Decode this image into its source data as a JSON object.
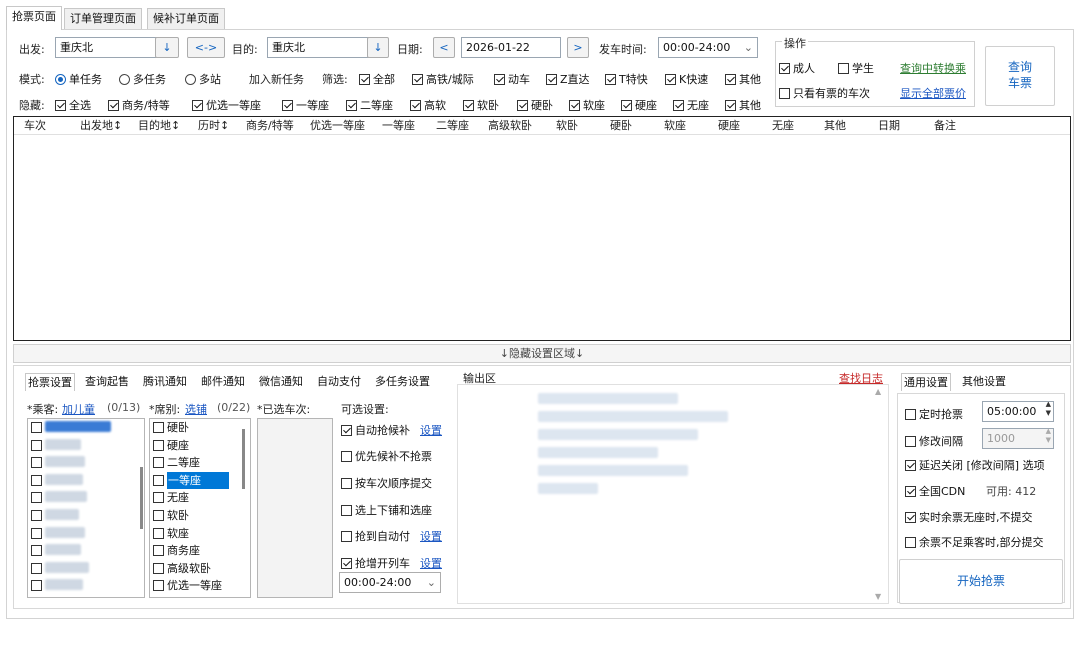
{
  "tabs": [
    "抢票页面",
    "订单管理页面",
    "候补订单页面"
  ],
  "route": {
    "from_label": "出发:",
    "from_value": "重庆北",
    "down_arrow": "↓",
    "swap": "<->",
    "to_label": "目的:",
    "to_value": "重庆北",
    "date_label": "日期:",
    "prev": "<",
    "date_value": "2026-01-22",
    "next": ">",
    "time_label": "发车时间:",
    "time_value": "00:00-24:00"
  },
  "mode": {
    "label": "模式:",
    "single": "单任务",
    "multi": "多任务",
    "multi_station": "多站",
    "add_task": "加入新任务",
    "filter_label": "筛选:",
    "filters": [
      "全部",
      "高铁/城际",
      "动车",
      "Z直达",
      "T特快",
      "K快速",
      "其他"
    ]
  },
  "hide": {
    "label": "隐藏:",
    "options": [
      "全选",
      "商务/特等",
      "优选一等座",
      "一等座",
      "二等座",
      "高软",
      "软卧",
      "硬卧",
      "软座",
      "硬座",
      "无座",
      "其他"
    ]
  },
  "ops": {
    "title": "操作",
    "adult": "成人",
    "student": "学生",
    "only_with_ticket": "只看有票的车次",
    "transfer_link": "查询中转换乘",
    "show_all_link": "显示全部票价",
    "query_btn_l1": "查询",
    "query_btn_l2": "车票"
  },
  "table": {
    "columns": [
      "车次",
      "出发地↕",
      "目的地↕",
      "历时↕",
      "商务/特等",
      "优选一等座",
      "一等座",
      "二等座",
      "高级软卧",
      "软卧",
      "硬卧",
      "软座",
      "硬座",
      "无座",
      "其他",
      "日期",
      "备注"
    ]
  },
  "splitter": "↓隐藏设置区域↓",
  "settings": {
    "tabs": [
      "抢票设置",
      "查询起售",
      "腾讯通知",
      "邮件通知",
      "微信通知",
      "自动支付",
      "多任务设置"
    ],
    "passenger_label": "*乘客:",
    "passenger_link": "加儿童",
    "passenger_count": "(0/13)",
    "seat_label": "*席别:",
    "seat_link": "选铺",
    "seat_count": "(0/22)",
    "selected_trains_label": "*已选车次:",
    "seats": [
      "硬卧",
      "硬座",
      "二等座",
      "一等座",
      "无座",
      "软卧",
      "软座",
      "商务座",
      "高级软卧",
      "优选一等座"
    ],
    "optional_label": "可选设置:",
    "options": [
      {
        "label": "自动抢候补",
        "checked": true,
        "link": "设置"
      },
      {
        "label": "优先候补不抢票",
        "checked": false,
        "link": ""
      },
      {
        "label": "按车次顺序提交",
        "checked": false,
        "link": ""
      },
      {
        "label": "选上下铺和选座",
        "checked": false,
        "link": ""
      },
      {
        "label": "抢到自动付",
        "checked": false,
        "link": "设置"
      },
      {
        "label": "抢增开列车",
        "checked": true,
        "link": "设置"
      }
    ],
    "time_range": "00:00-24:00"
  },
  "output": {
    "label": "输出区",
    "log_link": "查找日志"
  },
  "general": {
    "tabs": [
      "通用设置",
      "其他设置"
    ],
    "timed_label": "定时抢票",
    "timed_value": "05:00:00",
    "interval_label": "修改间隔",
    "interval_value": "1000",
    "delay_close": "延迟关闭 [修改间隔] 选项",
    "cdn": "全国CDN",
    "cdn_available": "可用: 412",
    "realtime": "实时余票无座时,不提交",
    "partial": "余票不足乘客时,部分提交",
    "start_btn": "开始抢票"
  },
  "colors": {
    "accent": "#1565c0",
    "link_green": "#2e7d32",
    "link_red": "#c62828",
    "selected": "#0078d7"
  }
}
